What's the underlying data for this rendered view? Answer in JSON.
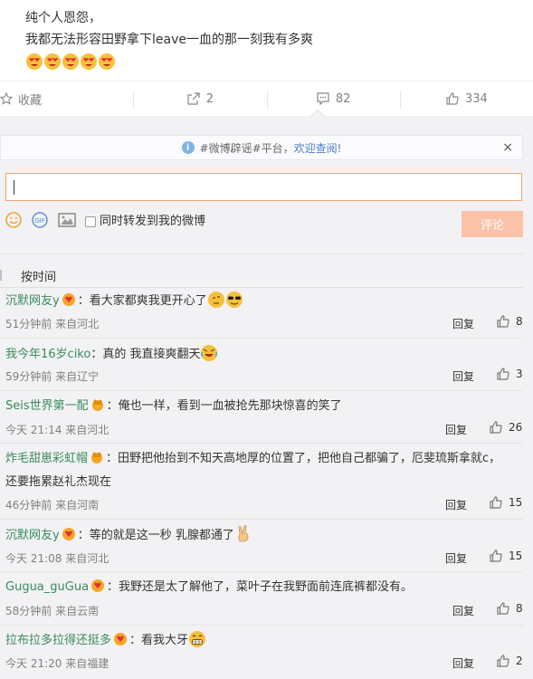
{
  "post": {
    "line1": "纯个人恩怨，",
    "line2": "我都无法形容田野拿下leave一血的那一刻我有多爽",
    "emoji_count": 5
  },
  "actions": {
    "favorite_label": "收藏",
    "forward_count": "2",
    "comment_count": "82",
    "like_count": "334"
  },
  "notice": {
    "prefix": "#微博辟谣#平台，",
    "highlight": "欢迎查阅!",
    "close": "×"
  },
  "composer": {
    "value": "",
    "sync_label": "同时转发到我的微博",
    "submit_label": "评论",
    "gif_label": "GIF"
  },
  "sort": {
    "label": "按时间"
  },
  "comments": [
    {
      "user": "沉默网友y",
      "text": "：看大家都爽我更开心了",
      "meta": "51分钟前 来自河北",
      "reply": "回复",
      "likes": "8"
    },
    {
      "user": "我今年16岁ciko",
      "text": "：真的 我直接爽翻天",
      "meta": "59分钟前 来自辽宁",
      "reply": "回复",
      "likes": "3"
    },
    {
      "user": "Seis世界第一配",
      "text": "：俺也一样，看到一血被抢先那块惊喜的笑了",
      "meta": "今天 21:14 来自河北",
      "reply": "回复",
      "likes": "26"
    },
    {
      "user": "炸毛甜崽彩虹帽",
      "text": "：田野把他抬到不知天高地厚的位置了，把他自己都骗了，厄斐琉斯拿就c，",
      "text2": "还要拖累赵礼杰现在",
      "meta": "46分钟前 来自河南",
      "reply": "回复",
      "likes": "15"
    },
    {
      "user": "沉默网友y",
      "text": "：等的就是这一秒 乳腺都通了",
      "meta": "今天 21:08 来自河北",
      "reply": "回复",
      "likes": "15"
    },
    {
      "user": "Gugua_guGua",
      "text": "：我野还是太了解他了，菜叶子在我野面前连底裤都没有。",
      "meta": "58分钟前 来自云南",
      "reply": "回复",
      "likes": "8"
    },
    {
      "user": "拉布拉多拉得还挺多",
      "text": "：看我大牙",
      "meta": "今天 21:20 来自福建",
      "reply": "回复",
      "likes": "2"
    }
  ],
  "colors": {
    "accent_orange": "#f2a36a",
    "submit_bg": "#fbc2a8",
    "username_green": "#3a8a5a",
    "panel_bg": "#f2f2f5"
  }
}
